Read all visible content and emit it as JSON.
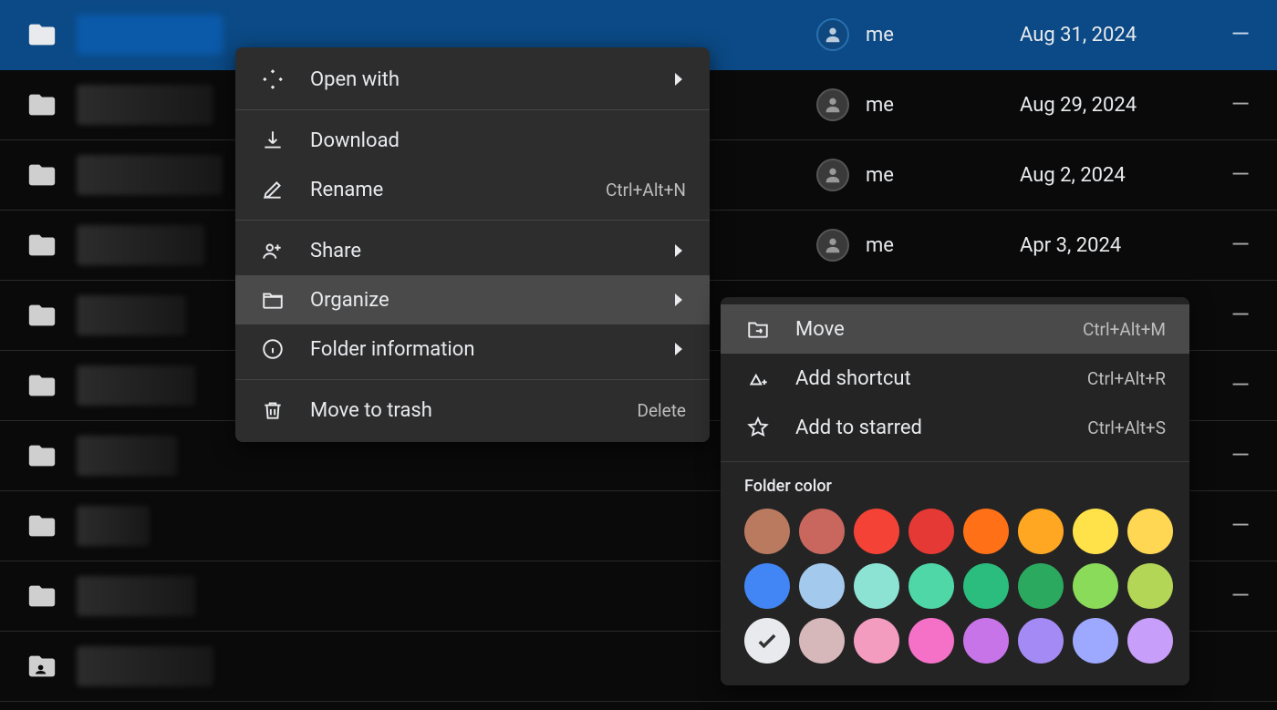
{
  "rows": [
    {
      "selected": true,
      "shared": false,
      "nameBlurWidth": 160,
      "owner": "me",
      "date": "Aug 31, 2024",
      "dash": "—",
      "showOwner": true,
      "showDate": true
    },
    {
      "selected": false,
      "shared": false,
      "nameBlurWidth": 150,
      "owner": "me",
      "date": "Aug 29, 2024",
      "dash": "—",
      "showOwner": true,
      "showDate": true
    },
    {
      "selected": false,
      "shared": false,
      "nameBlurWidth": 160,
      "owner": "me",
      "date": "Aug 2, 2024",
      "dash": "—",
      "showOwner": true,
      "showDate": true
    },
    {
      "selected": false,
      "shared": false,
      "nameBlurWidth": 140,
      "owner": "me",
      "date": "Apr 3, 2024",
      "dash": "—",
      "showOwner": true,
      "showDate": true
    },
    {
      "selected": false,
      "shared": false,
      "nameBlurWidth": 120,
      "owner": "",
      "date": "",
      "dash": "—",
      "showOwner": false,
      "showDate": false
    },
    {
      "selected": false,
      "shared": false,
      "nameBlurWidth": 130,
      "owner": "",
      "date": "",
      "dash": "—",
      "showOwner": false,
      "showDate": false
    },
    {
      "selected": false,
      "shared": false,
      "nameBlurWidth": 110,
      "owner": "",
      "date": "",
      "dash": "—",
      "showOwner": false,
      "showDate": false
    },
    {
      "selected": false,
      "shared": false,
      "nameBlurWidth": 80,
      "owner": "",
      "date": "",
      "dash": "—",
      "showOwner": false,
      "showDate": false
    },
    {
      "selected": false,
      "shared": false,
      "nameBlurWidth": 130,
      "owner": "",
      "date": "",
      "dash": "—",
      "showOwner": false,
      "showDate": false
    },
    {
      "selected": false,
      "shared": true,
      "nameBlurWidth": 150,
      "owner": "",
      "date": "",
      "dash": "",
      "showOwner": false,
      "showDate": false
    }
  ],
  "contextMenu": {
    "openWith": "Open with",
    "download": "Download",
    "rename": "Rename",
    "renameShortcut": "Ctrl+Alt+N",
    "share": "Share",
    "organize": "Organize",
    "folderInfo": "Folder information",
    "moveToTrash": "Move to trash",
    "deleteShortcut": "Delete"
  },
  "subMenu": {
    "move": "Move",
    "moveShortcut": "Ctrl+Alt+M",
    "addShortcut": "Add shortcut",
    "addShortcutShortcut": "Ctrl+Alt+R",
    "addToStarred": "Add to starred",
    "addToStarredShortcut": "Ctrl+Alt+S",
    "folderColorTitle": "Folder color"
  },
  "swatches": [
    "#b97a5f",
    "#c9675e",
    "#f44336",
    "#e53935",
    "#ff7017",
    "#ffa722",
    "#ffe14a",
    "#ffd752",
    "#4285f4",
    "#a3c9ec",
    "#8de3d3",
    "#4fd7a8",
    "#2bbd7d",
    "#2ba95e",
    "#8bdb5b",
    "#b3d657",
    "#e8eaed",
    "#d6b8bb",
    "#f49bc0",
    "#f571c8",
    "#c774e8",
    "#a48af4",
    "#9da8ff",
    "#c89efb"
  ],
  "selectedSwatchIndex": 16
}
